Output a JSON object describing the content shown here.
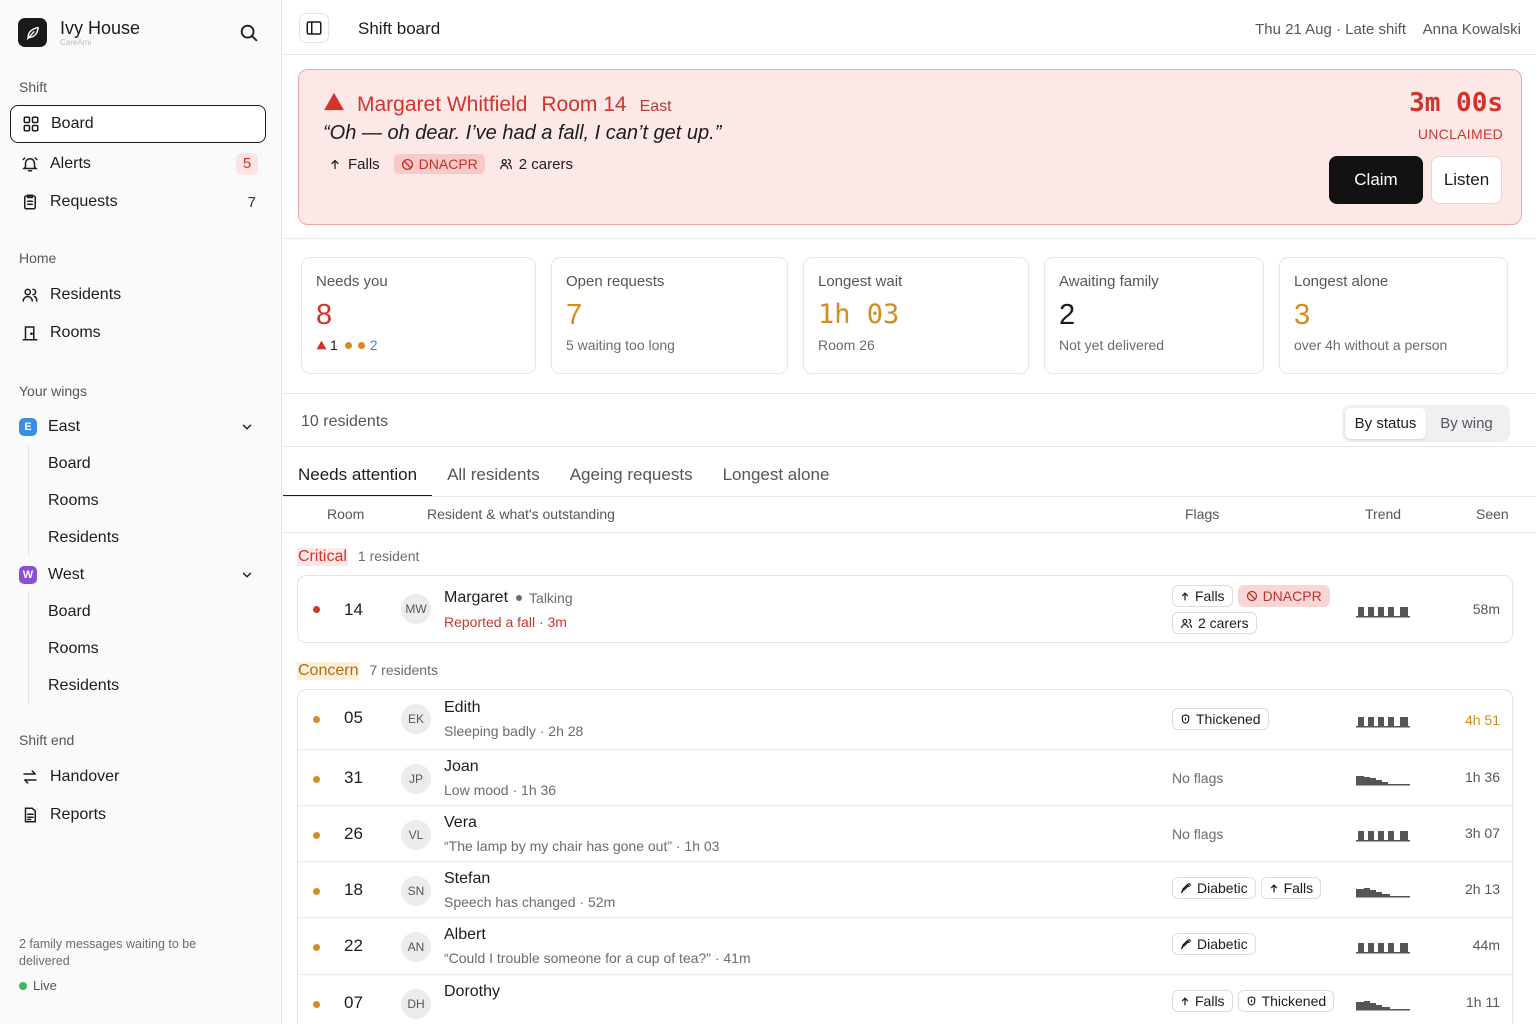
{
  "brand": {
    "name": "Ivy House",
    "sub": "CareAmi"
  },
  "sidebar": {
    "shift_title": "Shift",
    "shift_items": [
      {
        "label": "Board",
        "icon": "grid-icon",
        "count": ""
      },
      {
        "label": "Alerts",
        "icon": "bell-icon",
        "count": "5"
      },
      {
        "label": "Requests",
        "icon": "clipboard-icon",
        "count": "7"
      }
    ],
    "home_title": "Home",
    "home_items": [
      {
        "label": "Residents",
        "icon": "users-icon"
      },
      {
        "label": "Rooms",
        "icon": "door-icon"
      }
    ],
    "wings_title": "Your wings",
    "wings": [
      {
        "badge": "E",
        "name": "East",
        "color": "#3b8ee6",
        "items": [
          "Board",
          "Rooms",
          "Residents"
        ]
      },
      {
        "badge": "W",
        "name": "West",
        "color": "#8a4fd6",
        "items": [
          "Board",
          "Rooms",
          "Residents"
        ]
      }
    ],
    "shift_end_title": "Shift end",
    "shift_end_items": [
      {
        "label": "Handover",
        "icon": "swap-icon"
      },
      {
        "label": "Reports",
        "icon": "report-icon"
      }
    ],
    "footer_text": "2 family messages waiting to be delivered",
    "live_label": "Live"
  },
  "topbar": {
    "title": "Shift board",
    "date": "Thu 21 Aug · Late shift",
    "user": "Anna Kowalski"
  },
  "alert": {
    "name": "Margaret Whitfield",
    "room": "Room 14",
    "wing": "East",
    "quote": "“Oh — oh dear. I’ve had a fall, I can’t get up.”",
    "tags": {
      "falls": "Falls",
      "dnacpr": "DNACPR",
      "carers": "2 carers"
    },
    "timer": "3m 00s",
    "status": "UNCLAIMED",
    "claim_label": "Claim",
    "listen_label": "Listen"
  },
  "stats": [
    {
      "label": "Needs you",
      "value": "8",
      "sub_a": "1",
      "sub_b": "2",
      "color": "#d0342c"
    },
    {
      "label": "Open requests",
      "value": "7",
      "sub": "5 waiting too long",
      "color": "#d58b1f"
    },
    {
      "label": "Longest wait",
      "value": "1h 03",
      "sub": "Room 26",
      "color": "#d58b1f"
    },
    {
      "label": "Awaiting family",
      "value": "2",
      "sub": "Not yet delivered",
      "color": "#1c1c1e"
    },
    {
      "label": "Longest alone",
      "value": "3",
      "sub": "over 4h without a person",
      "color": "#d58b1f"
    }
  ],
  "residents": {
    "count_label": "10 residents",
    "view_by_status": "By status",
    "view_by_wing": "By wing",
    "tabs": [
      "Needs attention",
      "All residents",
      "Ageing requests",
      "Longest alone"
    ],
    "columns": {
      "room": "Room",
      "resident": "Resident & what's outstanding",
      "flags": "Flags",
      "trend": "Trend",
      "seen": "Seen"
    },
    "groups": {
      "critical": {
        "name": "Critical",
        "count": "1 resident"
      },
      "concern": {
        "name": "Concern",
        "count": "7 residents"
      }
    },
    "critical_rows": [
      {
        "room": "14",
        "initials": "MW",
        "name": "Margaret",
        "status": "Talking",
        "desc": "Reported a fall · 3m",
        "seen": "58m"
      }
    ],
    "concern_rows": [
      {
        "room": "05",
        "initials": "EK",
        "name": "Edith",
        "desc": "Sleeping badly · 2h 28",
        "seen": "4h 51"
      },
      {
        "room": "31",
        "initials": "JP",
        "name": "Joan",
        "desc": "Low mood · 1h 36",
        "seen": "1h 36"
      },
      {
        "room": "26",
        "initials": "VL",
        "name": "Vera",
        "desc": "“The lamp by my chair has gone out” · 1h 03",
        "seen": "3h 07"
      },
      {
        "room": "18",
        "initials": "SN",
        "name": "Stefan",
        "desc": "Speech has changed · 52m",
        "seen": "2h 13"
      },
      {
        "room": "22",
        "initials": "AN",
        "name": "Albert",
        "desc": "“Could I trouble someone for a cup of tea?” · 41m",
        "seen": "44m"
      },
      {
        "room": "07",
        "initials": "DH",
        "name": "Dorothy",
        "desc": "",
        "seen": "1h 11"
      }
    ],
    "flag_labels": {
      "falls": "Falls",
      "dnacpr": "DNACPR",
      "carers": "2 carers",
      "thickened": "Thickened",
      "diabetic": "Diabetic",
      "none": "No flags"
    }
  },
  "colors": {
    "critical": "#d0342c",
    "concern": "#d58b1f",
    "brand": "#1a1a1a"
  }
}
